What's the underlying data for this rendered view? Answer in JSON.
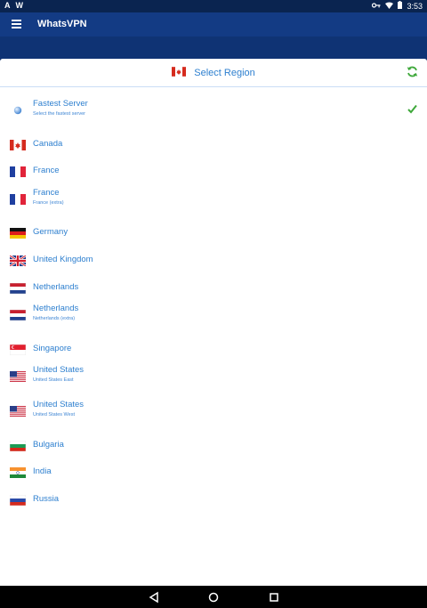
{
  "status_bar": {
    "time": "3:53",
    "left_letters": [
      "A",
      "W"
    ]
  },
  "app": {
    "title": "WhatsVPN"
  },
  "header": {
    "title": "Select Region",
    "flag": "canada-flag"
  },
  "regions": [
    {
      "name": "Fastest Server",
      "sub": "Select the fastest server",
      "flag": "globe",
      "selected": true
    },
    {
      "name": "Canada",
      "sub": "",
      "flag": "canada"
    },
    {
      "name": "France",
      "sub": "",
      "flag": "france"
    },
    {
      "name": "France",
      "sub": "France (extra)",
      "flag": "france"
    },
    {
      "name": "Germany",
      "sub": "",
      "flag": "germany"
    },
    {
      "name": "United Kingdom",
      "sub": "",
      "flag": "uk"
    },
    {
      "name": "Netherlands",
      "sub": "",
      "flag": "netherlands"
    },
    {
      "name": "Netherlands",
      "sub": "Netherlands (extra)",
      "flag": "netherlands"
    },
    {
      "name": "Singapore",
      "sub": "",
      "flag": "singapore"
    },
    {
      "name": "United States",
      "sub": "United States East",
      "flag": "usa"
    },
    {
      "name": "United States",
      "sub": "United States West",
      "flag": "usa"
    },
    {
      "name": "Bulgaria",
      "sub": "",
      "flag": "bulgaria"
    },
    {
      "name": "India",
      "sub": "",
      "flag": "india"
    },
    {
      "name": "Russia",
      "sub": "",
      "flag": "russia"
    }
  ],
  "colors": {
    "accent_blue": "#2d7fcf",
    "appbar": "#133b84",
    "check_green": "#3ea83a"
  }
}
